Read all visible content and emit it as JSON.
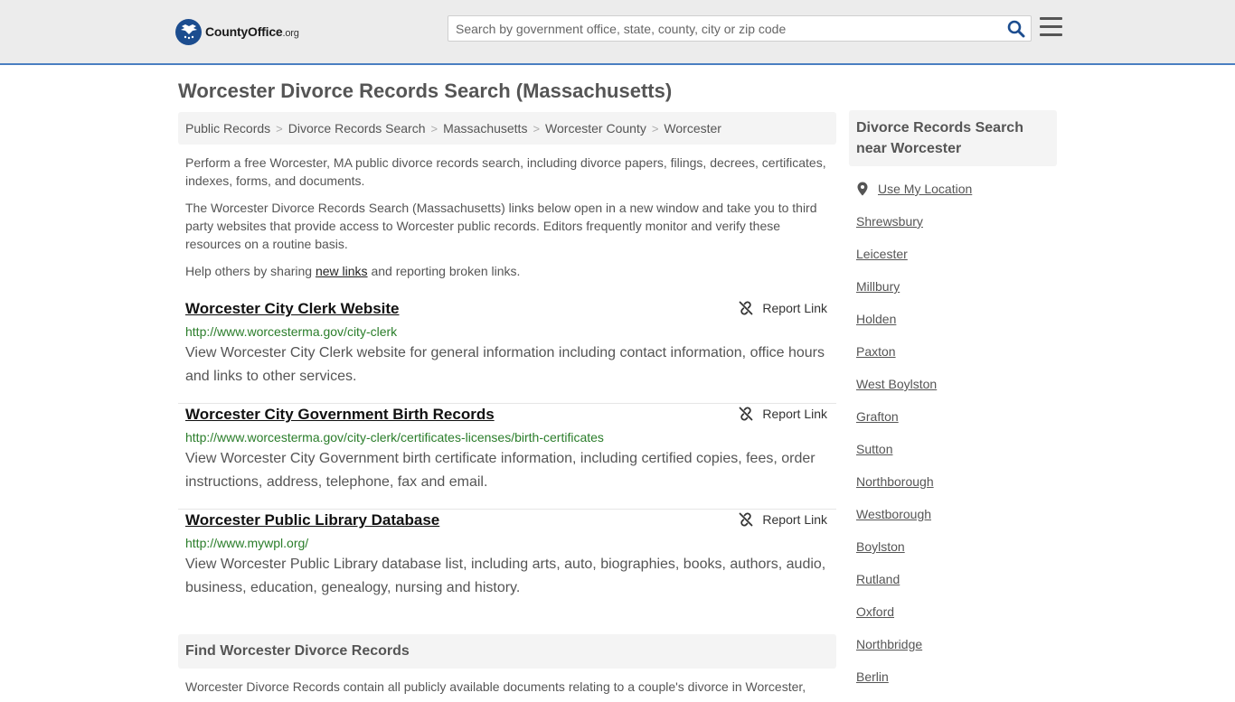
{
  "header": {
    "logo_main": "CountyOffice",
    "logo_suffix": ".org",
    "search_placeholder": "Search by government office, state, county, city or zip code"
  },
  "page_title": "Worcester Divorce Records Search (Massachusetts)",
  "breadcrumb": [
    "Public Records",
    "Divorce Records Search",
    "Massachusetts",
    "Worcester County",
    "Worcester"
  ],
  "intro": {
    "p1": "Perform a free Worcester, MA public divorce records search, including divorce papers, filings, decrees, certificates, indexes, forms, and documents.",
    "p2": "The Worcester Divorce Records Search (Massachusetts) links below open in a new window and take you to third party websites that provide access to Worcester public records. Editors frequently monitor and verify these resources on a routine basis.",
    "p3_before": "Help others by sharing",
    "p3_link": "new links",
    "p3_after": "and reporting broken links."
  },
  "report_label": "Report Link",
  "listings": [
    {
      "title": "Worcester City Clerk Website",
      "url": "http://www.worcesterma.gov/city-clerk",
      "desc": "View Worcester City Clerk website for general information including contact information, office hours and links to other services."
    },
    {
      "title": "Worcester City Government Birth Records",
      "url": "http://www.worcesterma.gov/city-clerk/certificates-licenses/birth-certificates",
      "desc": "View Worcester City Government birth certificate information, including certified copies, fees, order instructions, address, telephone, fax and email."
    },
    {
      "title": "Worcester Public Library Database",
      "url": "http://www.mywpl.org/",
      "desc": "View Worcester Public Library database list, including arts, auto, biographies, books, authors, audio, business, education, genealogy, nursing and history."
    }
  ],
  "find": {
    "title": "Find Worcester Divorce Records",
    "text": "Worcester Divorce Records contain all publicly available documents relating to a couple's divorce in Worcester,"
  },
  "sidebar": {
    "title": "Divorce Records Search near Worcester",
    "use_location": "Use My Location",
    "places": [
      "Shrewsbury",
      "Leicester",
      "Millbury",
      "Holden",
      "Paxton",
      "West Boylston",
      "Grafton",
      "Sutton",
      "Northborough",
      "Westborough",
      "Boylston",
      "Rutland",
      "Oxford",
      "Northbridge",
      "Berlin"
    ]
  },
  "colors": {
    "accent": "#4a7fc1",
    "link_green": "#2a7d2a",
    "search_icon": "#1c4d8f"
  }
}
